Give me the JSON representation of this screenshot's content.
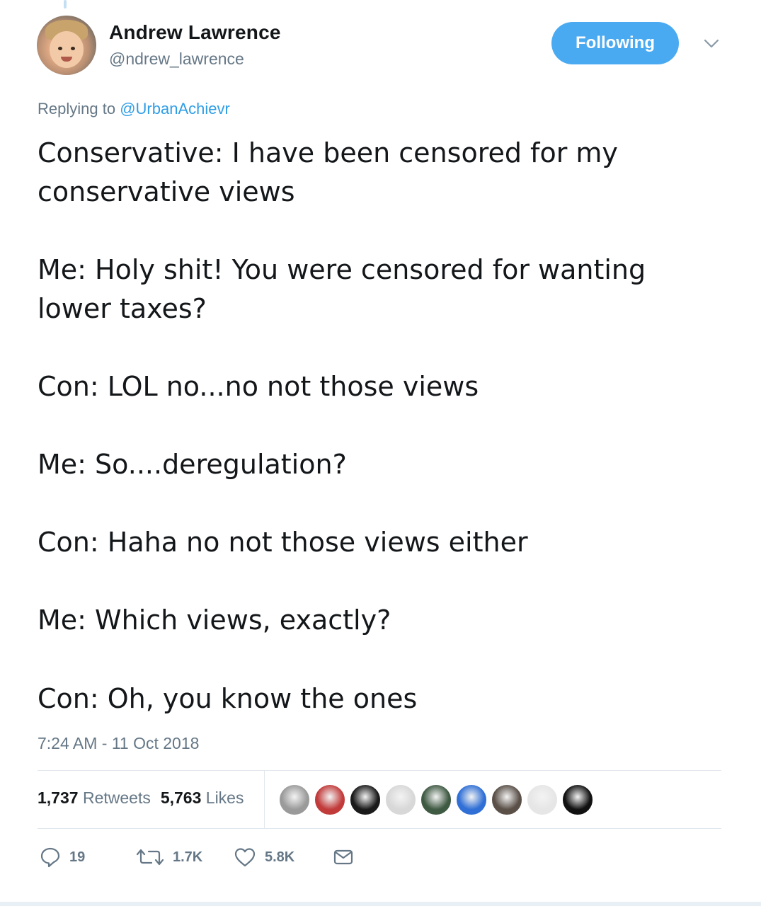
{
  "author": {
    "name": "Andrew Lawrence",
    "handle": "@ndrew_lawrence"
  },
  "follow_button_label": "Following",
  "reply_context": {
    "prefix": "Replying to",
    "mention": "@UrbanAchievr"
  },
  "tweet": {
    "lines": [
      "Conservative: I have been censored for my",
      "conservative views",
      "Me: Holy shit! You were censored for wanting",
      "lower taxes?",
      "Con: LOL no...no not those views",
      "Me: So....deregulation?",
      "Con: Haha no not those views either",
      "Me: Which views, exactly?",
      "Con: Oh, you know the ones"
    ],
    "timestamp": "7:24 AM - 11 Oct 2018"
  },
  "stats": {
    "retweets_count": "1,737",
    "retweets_label": "Retweets",
    "likes_count": "5,763",
    "likes_label": "Likes"
  },
  "liker_avatars": [
    {
      "name": "liker-avatar-1",
      "color": "#9a9a9a"
    },
    {
      "name": "liker-avatar-2",
      "color": "#c23b3b"
    },
    {
      "name": "liker-avatar-3",
      "color": "#1a1a1a"
    },
    {
      "name": "liker-avatar-4",
      "color": "#d8d8d8"
    },
    {
      "name": "liker-avatar-5",
      "color": "#3f5a43"
    },
    {
      "name": "liker-avatar-6",
      "color": "#2f6fd6"
    },
    {
      "name": "liker-avatar-7",
      "color": "#5a5048"
    },
    {
      "name": "liker-avatar-8",
      "color": "#e6e6e6"
    },
    {
      "name": "liker-avatar-9",
      "color": "#111111"
    }
  ],
  "actions": {
    "reply_count": "19",
    "retweet_count": "1.7K",
    "like_count": "5.8K"
  },
  "icons": [
    "reply-icon",
    "retweet-icon",
    "heart-icon",
    "envelope-icon",
    "chevron-down-icon"
  ],
  "colors": {
    "accent": "#4aaaf1",
    "mention": "#2f9ee6",
    "secondary_text": "#657786",
    "primary_text": "#14171a"
  }
}
